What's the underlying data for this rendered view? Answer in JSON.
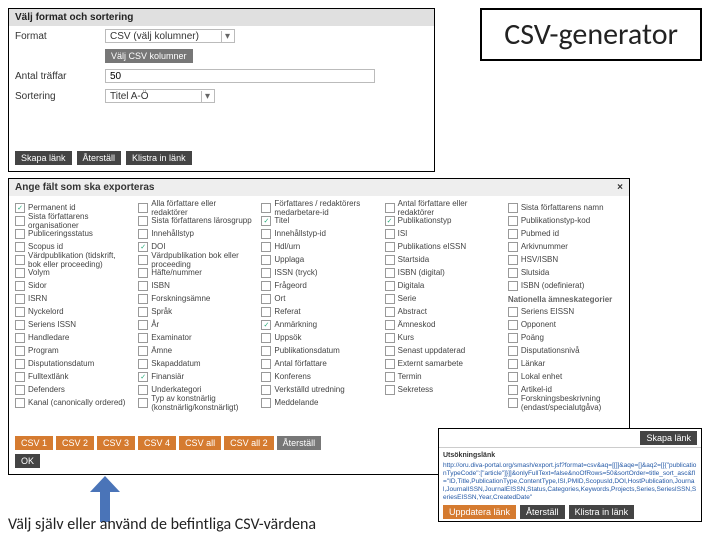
{
  "title_box": "CSV-generator",
  "top": {
    "heading": "Välj format och sortering",
    "format_label": "Format",
    "format_value": "CSV (välj kolumner)",
    "format_button": "Välj CSV kolumner",
    "hits_label": "Antal träffar",
    "hits_value": "50",
    "sort_label": "Sortering",
    "sort_value": "Titel A-Ö",
    "buttons": {
      "create": "Skapa länk",
      "reset": "Återställ",
      "paste": "Klistra in länk"
    }
  },
  "mid": {
    "heading": "Ange fält som ska exporteras",
    "close": "×",
    "cols": [
      [
        {
          "l": "Permanent id",
          "c": true,
          "sub": false
        },
        {
          "l": "Sista författarens organisationer",
          "c": false,
          "sub": false
        },
        {
          "l": "Publiceringsstatus",
          "c": false,
          "sub": false
        },
        {
          "l": "Scopus id",
          "c": false,
          "sub": false
        },
        {
          "l": "Värdpublikation (tidskrift, bok eller proceeding)",
          "c": false,
          "sub": false
        },
        {
          "l": "Volym",
          "c": false,
          "sub": false
        },
        {
          "l": "Sidor",
          "c": false,
          "sub": false
        },
        {
          "l": "ISRN",
          "c": false,
          "sub": false
        },
        {
          "l": "Nyckelord",
          "c": false,
          "sub": false
        },
        {
          "l": "Seriens ISSN",
          "c": false,
          "sub": false
        },
        {
          "l": "Handledare",
          "c": false,
          "sub": false
        },
        {
          "l": "Program",
          "c": false,
          "sub": false
        },
        {
          "l": "Disputationsdatum",
          "c": false,
          "sub": false
        },
        {
          "l": "Fulltextlänk",
          "c": false,
          "sub": false
        },
        {
          "l": "Defenders",
          "c": false,
          "sub": false
        },
        {
          "l": "Kanal (canonically ordered)",
          "c": false,
          "sub": false
        }
      ],
      [
        {
          "l": "Alla författare eller redaktörer",
          "c": false,
          "sub": false
        },
        {
          "l": "Sista författarens lärosgrupp",
          "c": false,
          "sub": false
        },
        {
          "l": "Innehållstyp",
          "c": false,
          "sub": false
        },
        {
          "l": "DOI",
          "c": true,
          "sub": false
        },
        {
          "l": "Värdpublikation bok eller proceeding",
          "c": false,
          "sub": false
        },
        {
          "l": "Häfte/nummer",
          "c": false,
          "sub": false
        },
        {
          "l": "ISBN",
          "c": false,
          "sub": false
        },
        {
          "l": "Forskningsämne",
          "c": false,
          "sub": false
        },
        {
          "l": "Språk",
          "c": false,
          "sub": false
        },
        {
          "l": "År",
          "c": false,
          "sub": false
        },
        {
          "l": "Examinator",
          "c": false,
          "sub": false
        },
        {
          "l": "Ämne",
          "c": false,
          "sub": false
        },
        {
          "l": "Skapaddatum",
          "c": false,
          "sub": false
        },
        {
          "l": "Finansiär",
          "c": true,
          "sub": false
        },
        {
          "l": "Underkategori",
          "c": false,
          "sub": false
        },
        {
          "l": "Typ av konstnärlig (konstnärlig/konstnärligt)",
          "c": false,
          "sub": false
        }
      ],
      [
        {
          "l": "Författares / redaktörers medarbetare-id",
          "c": false,
          "sub": false
        },
        {
          "l": "Titel",
          "c": true,
          "sub": false
        },
        {
          "l": "Innehållstyp-id",
          "c": false,
          "sub": false
        },
        {
          "l": "Hdl/urn",
          "c": false,
          "sub": false
        },
        {
          "l": "Upplaga",
          "c": false,
          "sub": false
        },
        {
          "l": "ISSN (tryck)",
          "c": false,
          "sub": false
        },
        {
          "l": "Frågeord",
          "c": false,
          "sub": false
        },
        {
          "l": "Ort",
          "c": false,
          "sub": false
        },
        {
          "l": "Referat",
          "c": false,
          "sub": false
        },
        {
          "l": "Anmärkning",
          "c": true,
          "sub": false
        },
        {
          "l": "Uppsök",
          "c": false,
          "sub": false
        },
        {
          "l": "Publikationsdatum",
          "c": false,
          "sub": false
        },
        {
          "l": "Antal författare",
          "c": false,
          "sub": false
        },
        {
          "l": "Konferens",
          "c": false,
          "sub": false
        },
        {
          "l": "Verkställd utredning",
          "c": false,
          "sub": false
        },
        {
          "l": "Meddelande",
          "c": false,
          "sub": false
        }
      ],
      [
        {
          "l": "Antal författare eller redaktörer",
          "c": false,
          "sub": false
        },
        {
          "l": "Publikationstyp",
          "c": true,
          "sub": false
        },
        {
          "l": "ISI",
          "c": false,
          "sub": false
        },
        {
          "l": "Publikations eISSN",
          "c": false,
          "sub": false
        },
        {
          "l": "Startsida",
          "c": false,
          "sub": false
        },
        {
          "l": "ISBN (digital)",
          "c": false,
          "sub": false
        },
        {
          "l": "Digitala",
          "c": false,
          "sub": false
        },
        {
          "l": "Serie",
          "c": false,
          "sub": false
        },
        {
          "l": "Abstract",
          "c": false,
          "sub": false
        },
        {
          "l": "Ämneskod",
          "c": false,
          "sub": false
        },
        {
          "l": "Kurs",
          "c": false,
          "sub": false
        },
        {
          "l": "Senast uppdaterad",
          "c": false,
          "sub": false
        },
        {
          "l": "Externt samarbete",
          "c": false,
          "sub": false
        },
        {
          "l": "Termin",
          "c": false,
          "sub": false
        },
        {
          "l": "Sekretess",
          "c": false,
          "sub": false
        }
      ],
      [
        {
          "l": "Sista författarens namn",
          "c": false,
          "sub": false
        },
        {
          "l": "Publikationstyp-kod",
          "c": false,
          "sub": false
        },
        {
          "l": "Pubmed id",
          "c": false,
          "sub": false
        },
        {
          "l": "Arkivnummer",
          "c": false,
          "sub": false
        },
        {
          "l": "HSV/ISBN",
          "c": false,
          "sub": false
        },
        {
          "l": "Slutsida",
          "c": false,
          "sub": false
        },
        {
          "l": "ISBN (odefinierat)",
          "c": false,
          "sub": false
        },
        {
          "l": "Nationella ämneskategorier",
          "c": false,
          "sub": true
        },
        {
          "l": "Seriens EISSN",
          "c": false,
          "sub": false
        },
        {
          "l": "Opponent",
          "c": false,
          "sub": false
        },
        {
          "l": "Poäng",
          "c": false,
          "sub": false
        },
        {
          "l": "Disputationsnivå",
          "c": false,
          "sub": false
        },
        {
          "l": "Länkar",
          "c": false,
          "sub": false
        },
        {
          "l": "Lokal enhet",
          "c": false,
          "sub": false
        },
        {
          "l": "Artikel-id",
          "c": false,
          "sub": false
        },
        {
          "l": "Forskningsbeskrivning (endast/specialutgåva)",
          "c": false,
          "sub": false
        }
      ]
    ],
    "presets": [
      "CSV 1",
      "CSV 2",
      "CSV 3",
      "CSV 4",
      "CSV all",
      "CSV all 2",
      "Återställ"
    ],
    "ok": "OK"
  },
  "caption": "Välj själv eller använd de befintliga CSV-värdena",
  "link": {
    "create": "Skapa länk",
    "title": "Utsökningslänk",
    "url": "http://oru.diva-portal.org/smash/export.jsf?format=csv&aq=[[]]&aqe=[]&aq2=[[{\"publicationTypeCode\":[\"article\"]}]]&onlyFullText=false&noOfRows=50&sortOrder=title_sort_asc&fl=\"ID,Title,PublicationType,ContentType,ISI,PMID,ScopusId,DOI,HostPublication,Journal,JournalISSN,JournalEISSN,Status,Categories,Keywords,Projects,Series,SeriesISSN,SeriesEISSN,Year,CreatedDate\"",
    "buttons": {
      "update": "Uppdatera länk",
      "reset": "Återställ",
      "paste": "Klistra in länk"
    }
  }
}
